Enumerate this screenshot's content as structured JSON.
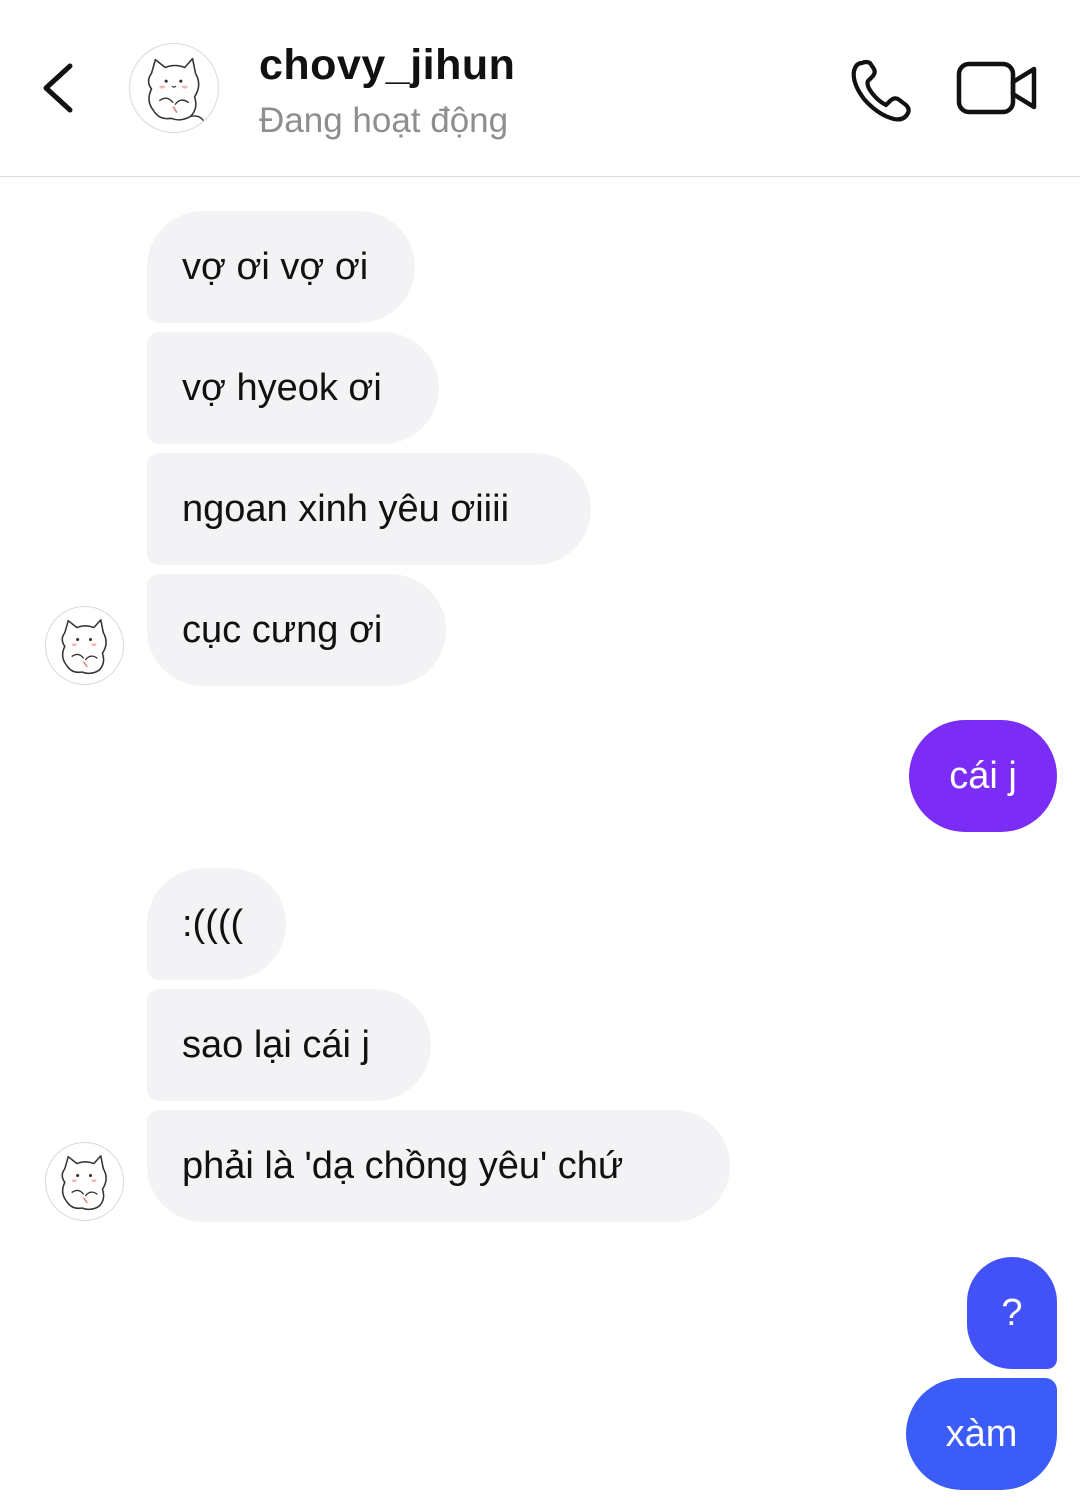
{
  "header": {
    "username": "chovy_jihun",
    "status": "Đang hoạt động",
    "icons": {
      "back": "chevron-left-icon",
      "call": "phone-icon",
      "video": "video-camera-icon"
    }
  },
  "messages": [
    {
      "sender": "them",
      "text": "vợ ơi vợ ơi"
    },
    {
      "sender": "them",
      "text": "vợ hyeok ơi"
    },
    {
      "sender": "them",
      "text": "ngoan xinh yêu ơiiii"
    },
    {
      "sender": "them",
      "text": "cục cưng ơi"
    },
    {
      "sender": "me",
      "text": "cái j"
    },
    {
      "sender": "them",
      "text": ":(((("
    },
    {
      "sender": "them",
      "text": "sao lại cái j"
    },
    {
      "sender": "them",
      "text": "phải là 'dạ chồng yêu' chứ"
    },
    {
      "sender": "me",
      "text": "?"
    },
    {
      "sender": "me",
      "text": "xàm"
    }
  ],
  "colors": {
    "incoming_bubble": "#f3f3f5",
    "outgoing_purple": "#7b2cf5",
    "outgoing_blue": "#3c5cf8",
    "status_gray": "#8e8e8e"
  }
}
